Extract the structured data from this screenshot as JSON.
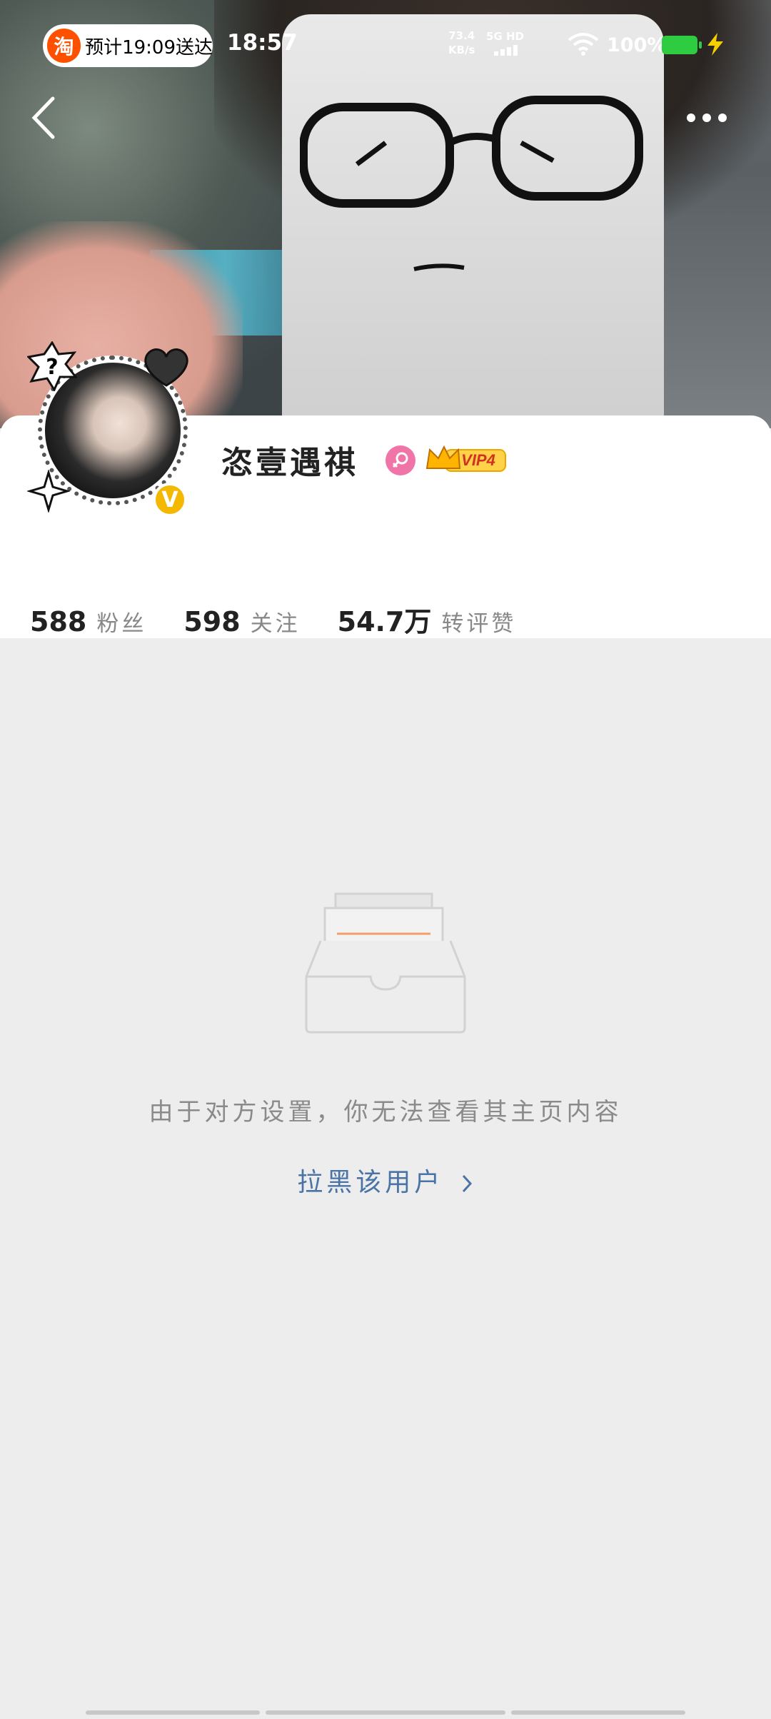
{
  "status": {
    "taobao_logo": "淘",
    "taobao_text": "预计19:09送达",
    "time": "18:57",
    "speed_value": "73.4",
    "speed_unit": "KB/s",
    "network": "5G HD",
    "battery": "100%"
  },
  "profile": {
    "name": "恣壹遇祺",
    "vip_label": "VIP4",
    "verified_mark": "V"
  },
  "stats": [
    {
      "value": "588",
      "label": "粉丝"
    },
    {
      "value": "598",
      "label": "关注"
    },
    {
      "value": "54.7万",
      "label": "转评赞"
    }
  ],
  "empty_state": {
    "message": "由于对方设置，你无法查看其主页内容",
    "action": "拉黑该用户"
  },
  "colors": {
    "background": "#ededed",
    "link": "#4a73a6",
    "verified": "#f5b800",
    "gender": "#f074a8",
    "battery": "#2ecc40"
  },
  "icons": [
    "back-arrow-icon",
    "more-dots-icon",
    "wifi-icon",
    "charging-bolt-icon",
    "female-gender-icon",
    "vip-crown-icon",
    "empty-inbox-icon",
    "chevron-right-icon"
  ]
}
